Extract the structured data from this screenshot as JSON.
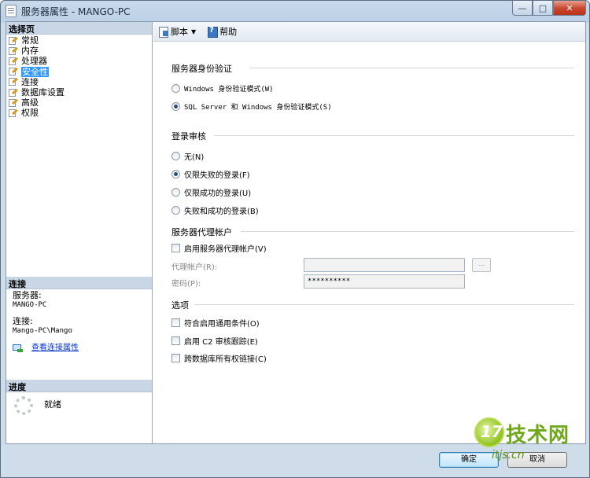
{
  "window": {
    "title": "服务器属性 - MANGO-PC"
  },
  "left": {
    "select_page_header": "选择页",
    "pages": [
      {
        "label": "常规"
      },
      {
        "label": "内存"
      },
      {
        "label": "处理器"
      },
      {
        "label": "安全性"
      },
      {
        "label": "连接"
      },
      {
        "label": "数据库设置"
      },
      {
        "label": "高级"
      },
      {
        "label": "权限"
      }
    ],
    "selected_page": "安全性",
    "connection_header": "连接",
    "server_label": "服务器:",
    "server_value": "MANGO-PC",
    "connection_label": "连接:",
    "connection_value": "Mango-PC\\Mango",
    "view_conn_link": "查看连接属性",
    "progress_header": "进度",
    "progress_status": "就绪"
  },
  "toolbar": {
    "script_label": "脚本",
    "help_label": "帮助"
  },
  "auth": {
    "title": "服务器身份验证",
    "windows_mode": "Windows 身份验证模式(W)",
    "mixed_mode": "SQL Server 和 Windows 身份验证模式(S)",
    "selected": "mixed"
  },
  "audit": {
    "title": "登录审核",
    "options": [
      "无(N)",
      "仅限失败的登录(F)",
      "仅限成功的登录(U)",
      "失败和成功的登录(B)"
    ],
    "selected_index": 1
  },
  "proxy": {
    "title": "服务器代理帐户",
    "enable_label": "启用服务器代理帐户(V)",
    "enabled": false,
    "account_label": "代理帐户(R):",
    "account_value": "",
    "password_label": "密码(P):",
    "password_value": "**********",
    "browse_label": "..."
  },
  "options": {
    "title": "选项",
    "items": [
      {
        "label": "符合启用通用条件(O)",
        "checked": false
      },
      {
        "label": "启用 C2 审核跟踪(E)",
        "checked": false
      },
      {
        "label": "跨数据库所有权链接(C)",
        "checked": false
      }
    ]
  },
  "buttons": {
    "ok": "确定",
    "cancel": "取消"
  },
  "watermark": {
    "main": "技术网",
    "sub": "itjs.cn",
    "logo": "17"
  },
  "colors": {
    "selection": "#3399ff",
    "header_bg": "#c9d6e5",
    "link": "#0033cc"
  }
}
